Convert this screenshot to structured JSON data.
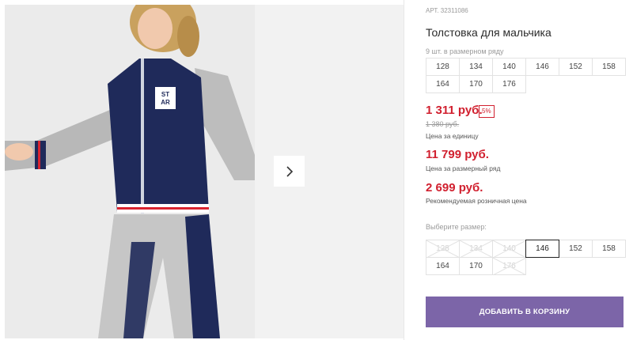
{
  "gallery": {
    "next_icon": "chevron-right-icon"
  },
  "product": {
    "article": "АРТ. 32311086",
    "title": "Толстовка для мальчика",
    "size_range_label": "9 шт. в размерном ряду",
    "size_range": [
      "128",
      "134",
      "140",
      "146",
      "152",
      "158",
      "164",
      "170",
      "176"
    ],
    "price_unit": "1 311 руб.",
    "discount": "5%",
    "old_price": "1 380 руб.",
    "price_unit_note": "Цена за единицу",
    "price_range": "11 799 руб.",
    "price_range_note": "Цена за размерный ряд",
    "price_retail": "2 699 руб.",
    "price_retail_note": "Рекомендуемая розничная цена",
    "choose_size_label": "Выберите размер:",
    "sizes": [
      {
        "label": "128",
        "state": "disabled"
      },
      {
        "label": "134",
        "state": "disabled"
      },
      {
        "label": "140",
        "state": "disabled"
      },
      {
        "label": "146",
        "state": "selected"
      },
      {
        "label": "152",
        "state": "available"
      },
      {
        "label": "158",
        "state": "available"
      },
      {
        "label": "164",
        "state": "available"
      },
      {
        "label": "170",
        "state": "available"
      },
      {
        "label": "176",
        "state": "disabled"
      }
    ],
    "add_to_cart": "ДОБАВИТЬ В КОРЗИНУ"
  },
  "colors": {
    "price_red": "#d1202f",
    "button_purple": "#7c65a8"
  }
}
